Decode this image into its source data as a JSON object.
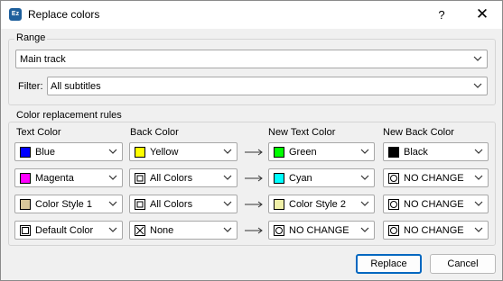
{
  "window": {
    "title": "Replace colors",
    "app_icon_text": "Ez",
    "help_label": "?",
    "close_label": "✕"
  },
  "range": {
    "group_label": "Range",
    "track_value": "Main track",
    "filter_label": "Filter:",
    "filter_value": "All subtitles"
  },
  "rules": {
    "group_label": "Color replacement rules",
    "headers": {
      "text_color": "Text Color",
      "back_color": "Back Color",
      "new_text_color": "New Text Color",
      "new_back_color": "New Back Color"
    },
    "rows": [
      {
        "text": {
          "label": "Blue",
          "swatch": "#0000ff",
          "kind": "solid"
        },
        "back": {
          "label": "Yellow",
          "swatch": "#ffff00",
          "kind": "solid"
        },
        "new_text": {
          "label": "Green",
          "swatch": "#00ff00",
          "kind": "solid"
        },
        "new_back": {
          "label": "Black",
          "swatch": "#000000",
          "kind": "solid"
        }
      },
      {
        "text": {
          "label": "Magenta",
          "swatch": "#ff00ff",
          "kind": "solid"
        },
        "back": {
          "label": "All Colors",
          "swatch": "",
          "kind": "all"
        },
        "new_text": {
          "label": "Cyan",
          "swatch": "#00ffff",
          "kind": "solid"
        },
        "new_back": {
          "label": "NO CHANGE",
          "swatch": "",
          "kind": "nochange"
        }
      },
      {
        "text": {
          "label": "Color Style 1",
          "swatch": "#d8c89a",
          "kind": "solid"
        },
        "back": {
          "label": "All Colors",
          "swatch": "",
          "kind": "all"
        },
        "new_text": {
          "label": "Color Style 2",
          "swatch": "#f0f0a8",
          "kind": "solid"
        },
        "new_back": {
          "label": "NO CHANGE",
          "swatch": "",
          "kind": "nochange"
        }
      },
      {
        "text": {
          "label": "Default Color",
          "swatch": "",
          "kind": "default"
        },
        "back": {
          "label": "None",
          "swatch": "",
          "kind": "none"
        },
        "new_text": {
          "label": "NO CHANGE",
          "swatch": "",
          "kind": "nochange"
        },
        "new_back": {
          "label": "NO CHANGE",
          "swatch": "",
          "kind": "nochange"
        }
      }
    ]
  },
  "buttons": {
    "replace": "Replace",
    "cancel": "Cancel"
  },
  "colors": {
    "accent": "#0067c0",
    "border": "#a8a8a8",
    "arrow": "#333333"
  }
}
